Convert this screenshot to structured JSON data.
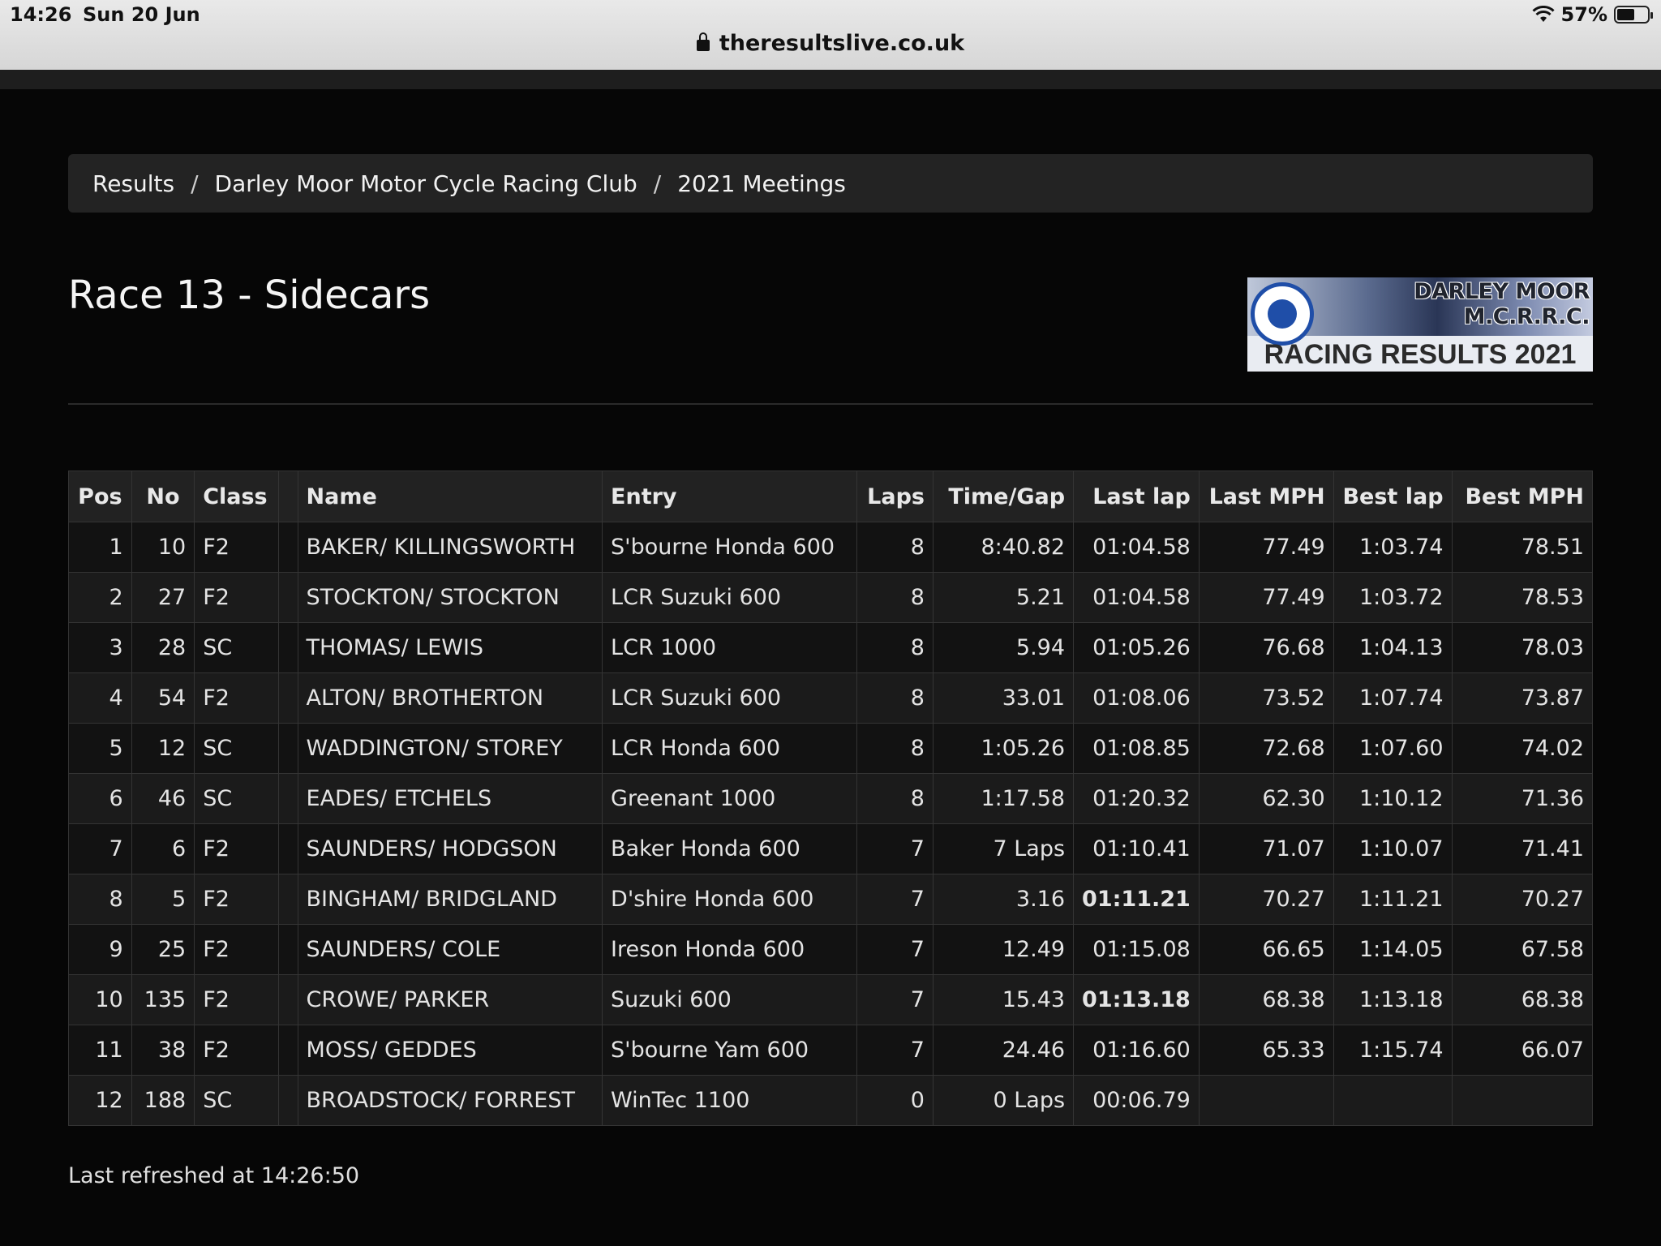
{
  "status": {
    "time": "14:26",
    "date": "Sun 20 Jun",
    "battery": "57%",
    "battery_level": 0.57,
    "url": "theresultslive.co.uk"
  },
  "breadcrumb": [
    "Results",
    "Darley Moor Motor Cycle Racing Club",
    "2021 Meetings"
  ],
  "breadcrumb_separator": "/",
  "page_title": "Race 13 - Sidecars",
  "logo": {
    "name": "DARLEY MOOR M.C.R.R.C.",
    "subtitle": "RACING RESULTS 2021"
  },
  "table": {
    "headers": [
      "Pos",
      "No",
      "Class",
      "",
      "Name",
      "Entry",
      "Laps",
      "Time/Gap",
      "Last lap",
      "Last MPH",
      "Best lap",
      "Best MPH"
    ],
    "rows": [
      {
        "pos": "1",
        "no": "10",
        "class": "F2",
        "name": "BAKER/ KILLINGSWORTH",
        "entry": "S'bourne Honda 600",
        "laps": "8",
        "gap": "8:40.82",
        "last_lap": "01:04.58",
        "last_mph": "77.49",
        "best_lap": "1:03.74",
        "best_mph": "78.51"
      },
      {
        "pos": "2",
        "no": "27",
        "class": "F2",
        "name": "STOCKTON/ STOCKTON",
        "entry": "LCR Suzuki 600",
        "laps": "8",
        "gap": "5.21",
        "last_lap": "01:04.58",
        "last_mph": "77.49",
        "best_lap": "1:03.72",
        "best_mph": "78.53",
        "best_lap_style": "best"
      },
      {
        "pos": "3",
        "no": "28",
        "class": "SC",
        "name": "THOMAS/ LEWIS",
        "entry": "LCR 1000",
        "laps": "8",
        "gap": "5.94",
        "last_lap": "01:05.26",
        "last_mph": "76.68",
        "best_lap": "1:04.13",
        "best_mph": "78.03"
      },
      {
        "pos": "4",
        "no": "54",
        "class": "F2",
        "name": "ALTON/ BROTHERTON",
        "entry": "LCR Suzuki 600",
        "laps": "8",
        "gap": "33.01",
        "last_lap": "01:08.06",
        "last_mph": "73.52",
        "best_lap": "1:07.74",
        "best_mph": "73.87"
      },
      {
        "pos": "5",
        "no": "12",
        "class": "SC",
        "name": "WADDINGTON/ STOREY",
        "entry": "LCR Honda 600",
        "laps": "8",
        "gap": "1:05.26",
        "last_lap": "01:08.85",
        "last_mph": "72.68",
        "best_lap": "1:07.60",
        "best_mph": "74.02"
      },
      {
        "pos": "6",
        "no": "46",
        "class": "SC",
        "name": "EADES/ ETCHELS",
        "entry": "Greenant 1000",
        "laps": "8",
        "gap": "1:17.58",
        "last_lap": "01:20.32",
        "last_mph": "62.30",
        "best_lap": "1:10.12",
        "best_mph": "71.36"
      },
      {
        "pos": "7",
        "no": "6",
        "class": "F2",
        "name": "SAUNDERS/ HODGSON",
        "entry": "Baker Honda 600",
        "laps": "7",
        "gap": "7 Laps",
        "last_lap": "01:10.41",
        "last_mph": "71.07",
        "best_lap": "1:10.07",
        "best_mph": "71.41"
      },
      {
        "pos": "8",
        "no": "5",
        "class": "F2",
        "name": "BINGHAM/ BRIDGLAND",
        "entry": "D'shire Honda 600",
        "laps": "7",
        "gap": "3.16",
        "last_lap": "01:11.21",
        "last_mph": "70.27",
        "best_lap": "1:11.21",
        "best_mph": "70.27",
        "last_lap_style": "pb"
      },
      {
        "pos": "9",
        "no": "25",
        "class": "F2",
        "name": "SAUNDERS/ COLE",
        "entry": "Ireson Honda 600",
        "laps": "7",
        "gap": "12.49",
        "last_lap": "01:15.08",
        "last_mph": "66.65",
        "best_lap": "1:14.05",
        "best_mph": "67.58"
      },
      {
        "pos": "10",
        "no": "135",
        "class": "F2",
        "name": "CROWE/ PARKER",
        "entry": "Suzuki 600",
        "laps": "7",
        "gap": "15.43",
        "last_lap": "01:13.18",
        "last_mph": "68.38",
        "best_lap": "1:13.18",
        "best_mph": "68.38",
        "last_lap_style": "pb"
      },
      {
        "pos": "11",
        "no": "38",
        "class": "F2",
        "name": "MOSS/ GEDDES",
        "entry": "S'bourne Yam 600",
        "laps": "7",
        "gap": "24.46",
        "last_lap": "01:16.60",
        "last_mph": "65.33",
        "best_lap": "1:15.74",
        "best_mph": "66.07"
      },
      {
        "pos": "12",
        "no": "188",
        "class": "SC",
        "name": "BROADSTOCK/ FORREST",
        "entry": "WinTec 1100",
        "laps": "0",
        "gap": "0 Laps",
        "last_lap": "00:06.79",
        "last_mph": "",
        "best_lap": "",
        "best_mph": ""
      }
    ]
  },
  "footer": {
    "refreshed": "Last refreshed at 14:26:50"
  },
  "colors": {
    "overall_best": "#e23ce0",
    "personal_best": "#5fd13a",
    "background": "#060606"
  }
}
